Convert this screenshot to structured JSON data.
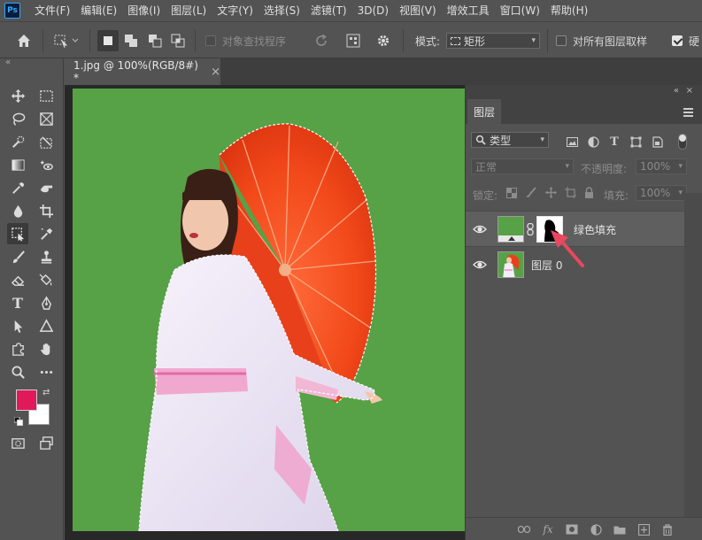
{
  "app": {
    "logo": "Ps"
  },
  "menu": {
    "items": [
      "文件(F)",
      "编辑(E)",
      "图像(I)",
      "图层(L)",
      "文字(Y)",
      "选择(S)",
      "滤镜(T)",
      "3D(D)",
      "视图(V)",
      "增效工具",
      "窗口(W)",
      "帮助(H)"
    ]
  },
  "options": {
    "object_finder_label": "对象查找程序",
    "mode_label": "模式:",
    "mode_value": "矩形",
    "sample_all_label": "对所有图层取样",
    "enhance_label": "硬"
  },
  "document": {
    "tab_title": "1.jpg @ 100%(RGB/8#) *",
    "close_glyph": "×",
    "canvas_color": "#57a146"
  },
  "layers_panel": {
    "tab_label": "图层",
    "filter_kind": "类型",
    "blend_mode": "正常",
    "opacity_label": "不透明度:",
    "opacity_value": "100%",
    "lock_label": "锁定:",
    "fill_label": "填充:",
    "fill_value": "100%",
    "layers": [
      {
        "name": "绿色填充",
        "type": "fill",
        "color": "#57a146"
      },
      {
        "name": "图层 0",
        "type": "image"
      }
    ],
    "bottom_fx_label": "fx"
  },
  "colors": {
    "foreground": "#e0195a",
    "background": "#ffffff",
    "annotation_arrow": "#e8485f"
  }
}
